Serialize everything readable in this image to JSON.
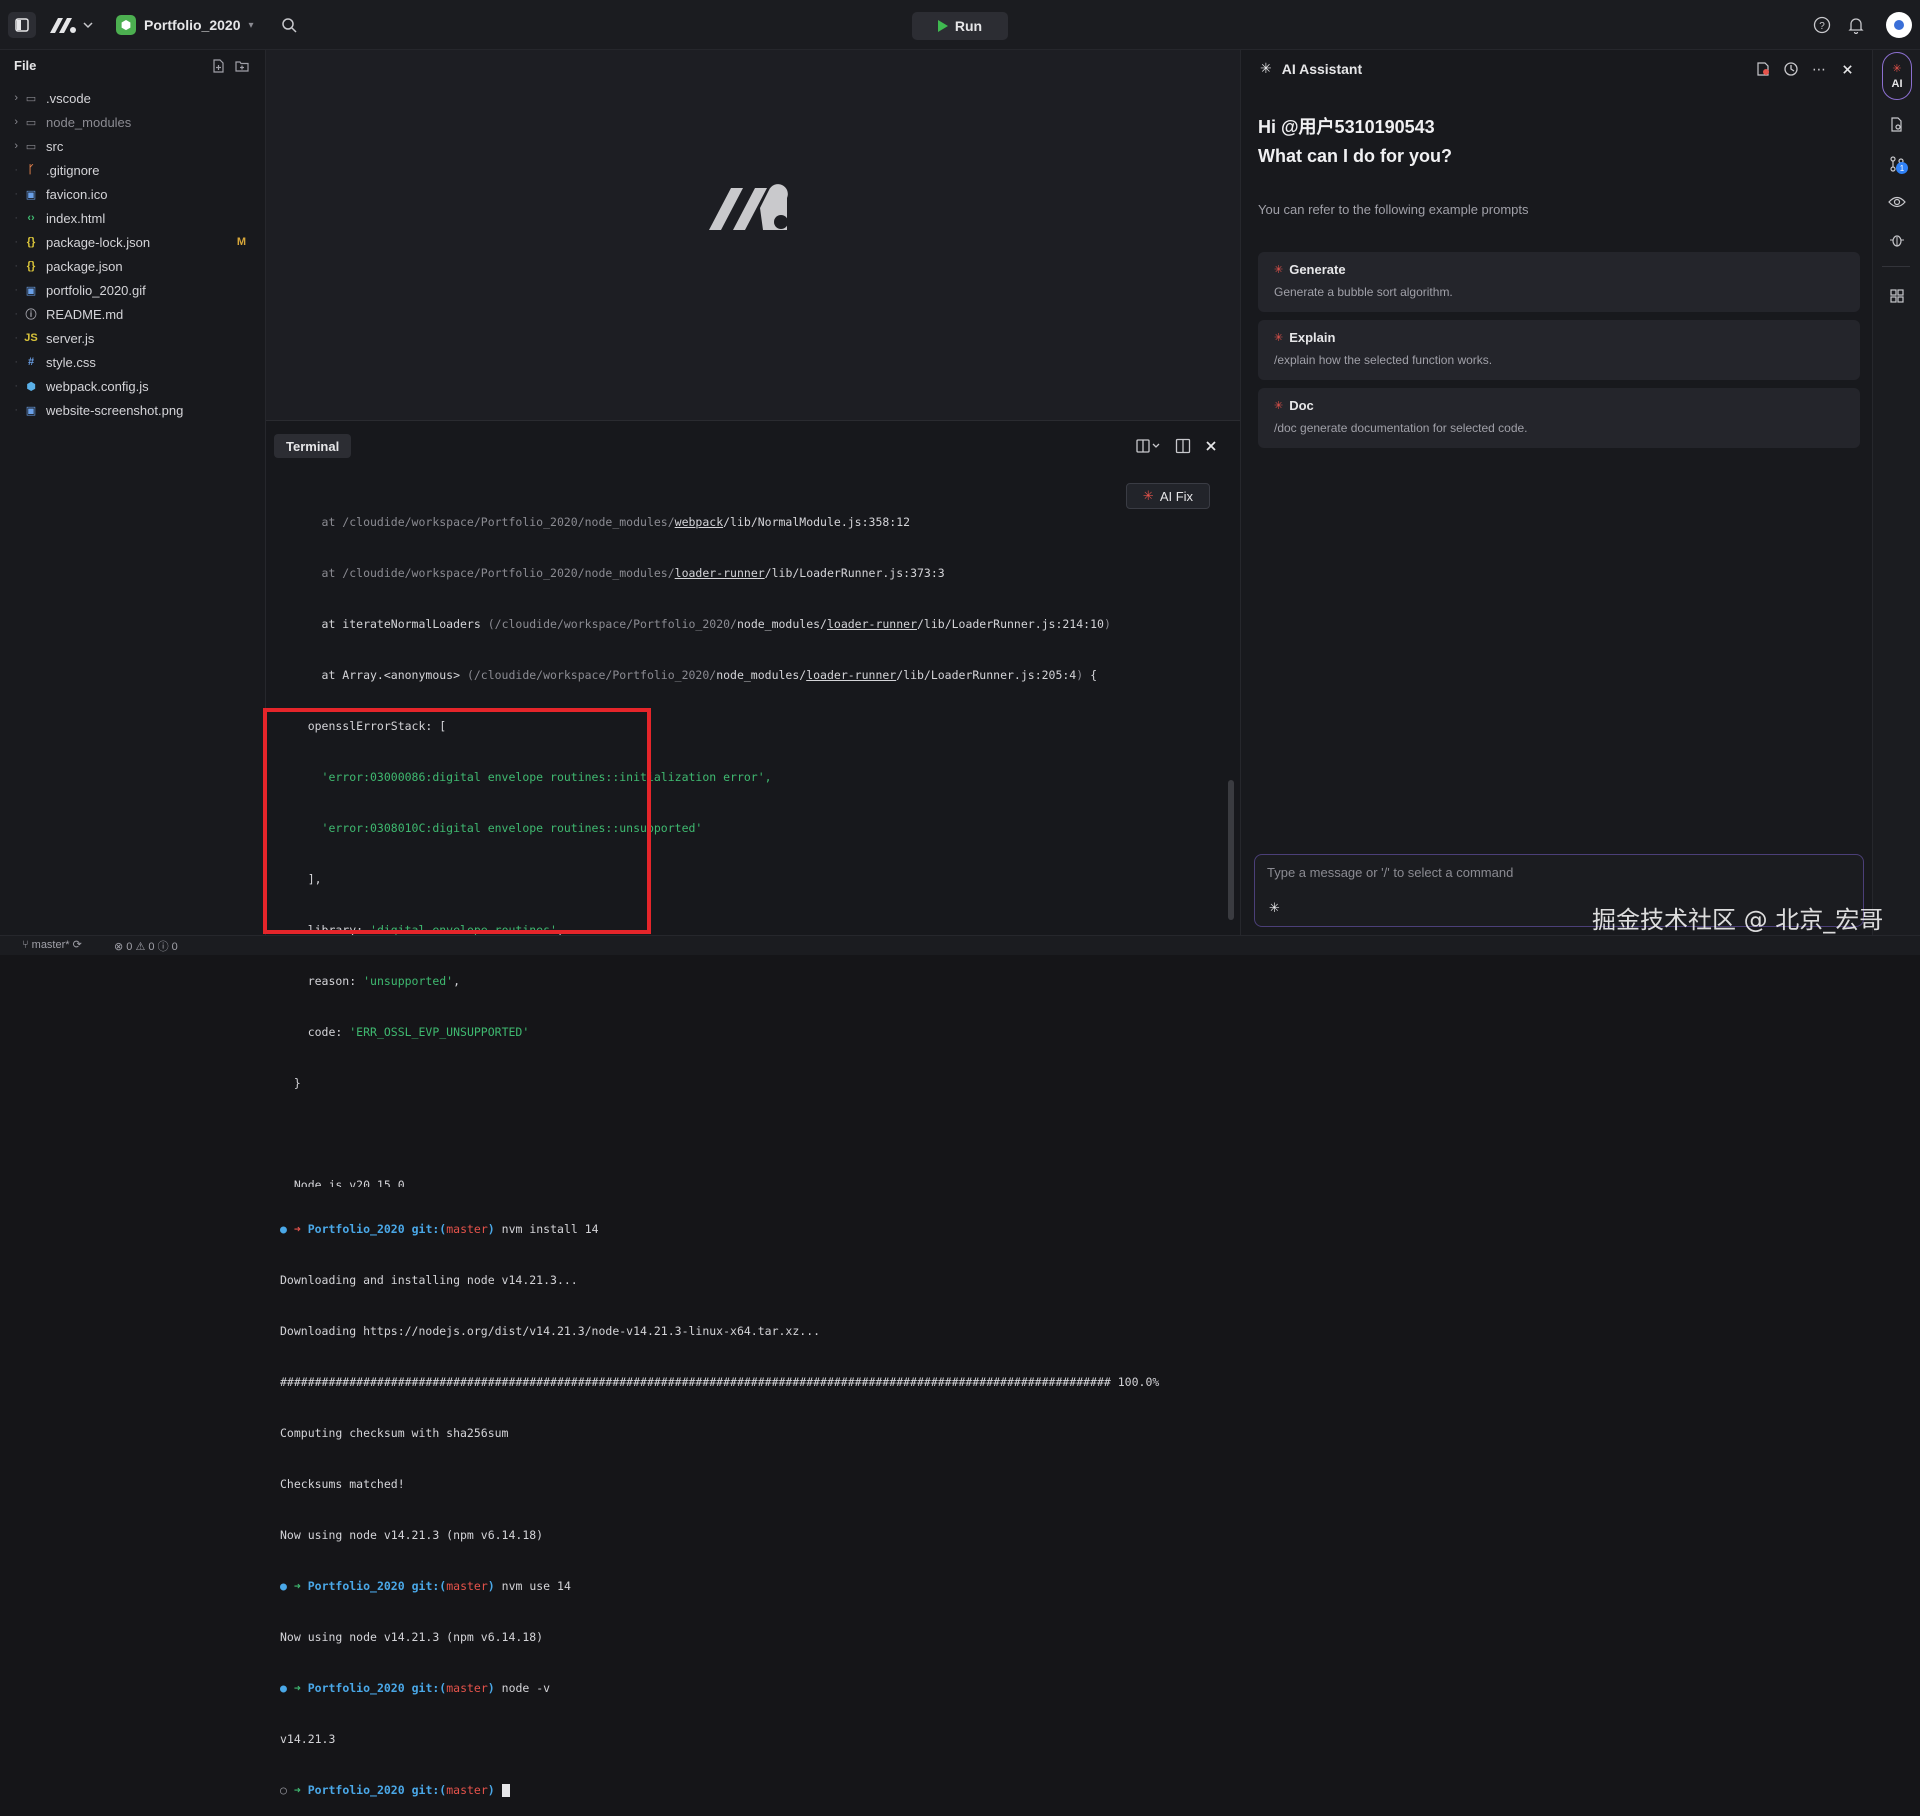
{
  "topbar": {
    "project_name": "Portfolio_2020",
    "run_label": "Run"
  },
  "file_panel": {
    "title": "File",
    "items": [
      {
        "name": ".vscode",
        "type": "folder",
        "icon": "folder-icon",
        "badge": ""
      },
      {
        "name": "node_modules",
        "type": "folder",
        "icon": "folder-icon",
        "badge": ""
      },
      {
        "name": "src",
        "type": "folder",
        "icon": "folder-icon",
        "badge": ""
      },
      {
        "name": ".gitignore",
        "type": "file",
        "icon": "git-icon",
        "badge": ""
      },
      {
        "name": "favicon.ico",
        "type": "file",
        "icon": "image-icon",
        "badge": ""
      },
      {
        "name": "index.html",
        "type": "file",
        "icon": "html-icon",
        "badge": ""
      },
      {
        "name": "package-lock.json",
        "type": "file",
        "icon": "json-icon",
        "badge": "M"
      },
      {
        "name": "package.json",
        "type": "file",
        "icon": "json-icon",
        "badge": ""
      },
      {
        "name": "portfolio_2020.gif",
        "type": "file",
        "icon": "image-icon",
        "badge": ""
      },
      {
        "name": "README.md",
        "type": "file",
        "icon": "info-icon",
        "badge": ""
      },
      {
        "name": "server.js",
        "type": "file",
        "icon": "js-icon",
        "badge": ""
      },
      {
        "name": "style.css",
        "type": "file",
        "icon": "css-icon",
        "badge": ""
      },
      {
        "name": "webpack.config.js",
        "type": "file",
        "icon": "webpack-icon",
        "badge": ""
      },
      {
        "name": "website-screenshot.png",
        "type": "file",
        "icon": "image-icon",
        "badge": ""
      }
    ]
  },
  "terminal": {
    "tab_label": "Terminal",
    "ai_fix_label": "AI Fix",
    "lines": [
      {
        "t": "      at /cloudide/workspace/Portfolio_2020/node_modules/webpack/lib/NormalModule.js:358:12"
      },
      {
        "t": "      at /cloudide/workspace/Portfolio_2020/node_modules/loader-runner/lib/LoaderRunner.js:373:3"
      },
      {
        "t": "      at iterateNormalLoaders (/cloudide/workspace/Portfolio_2020/node_modules/loader-runner/lib/LoaderRunner.js:214:10)"
      },
      {
        "t": "      at Array.<anonymous> (/cloudide/workspace/Portfolio_2020/node_modules/loader-runner/lib/LoaderRunner.js:205:4) {"
      },
      {
        "t": "    opensslErrorStack: ["
      },
      {
        "t": "      'error:03000086:digital envelope routines::initialization error',"
      },
      {
        "t": "      'error:0308010C:digital envelope routines::unsupported'"
      },
      {
        "t": "    ],"
      },
      {
        "t": "    library: 'digital envelope routines',"
      },
      {
        "t": "    reason: 'unsupported',"
      },
      {
        "t": "    code: 'ERR_OSSL_EVP_UNSUPPORTED'"
      },
      {
        "t": "  }"
      },
      {
        "t": ""
      },
      {
        "t": "  Node.js v20.15.0"
      },
      {
        "t": "Downloading and installing node v14.21.3..."
      },
      {
        "t": "Downloading https://nodejs.org/dist/v14.21.3/node-v14.21.3-linux-x64.tar.xz..."
      },
      {
        "t": "######################################################################################################################## 100.0%"
      },
      {
        "t": "Computing checksum with sha256sum"
      },
      {
        "t": "Checksums matched!"
      },
      {
        "t": "Now using node v14.21.3 (npm v6.14.18)"
      },
      {
        "t": "Now using node v14.21.3 (npm v6.14.18)"
      },
      {
        "t": "v14.21.3"
      }
    ],
    "prompt_dir": "Portfolio_2020",
    "prompt_git": "git:(",
    "prompt_branch": "master",
    "prompt_close": ")",
    "cmd_install": "nvm install 14",
    "cmd_use": "nvm use 14",
    "cmd_node": "node -v"
  },
  "ai_assistant": {
    "title": "AI Assistant",
    "greeting_line1": "Hi @用户5310190543",
    "greeting_line2": "What can I do for you?",
    "hint": "You can refer to the following example prompts",
    "prompts": [
      {
        "title": "Generate",
        "desc": "Generate a bubble sort algorithm."
      },
      {
        "title": "Explain",
        "desc": "/explain how the selected function works."
      },
      {
        "title": "Doc",
        "desc": "/doc generate documentation for selected code."
      }
    ],
    "input_placeholder": "Type a message or '/' to select a command"
  },
  "rail": {
    "ai_label": "AI",
    "git_badge": "1"
  },
  "statusbar": {
    "branch": "master*",
    "errors": "0",
    "warnings": "0",
    "info": "0"
  },
  "watermark": "掘金技术社区 @ 北京_宏哥",
  "colors": {
    "accent_run": "#3fb950",
    "red_highlight": "#e5252a",
    "prompt_blue": "#4aa8e8",
    "branch_red": "#e5534b"
  }
}
